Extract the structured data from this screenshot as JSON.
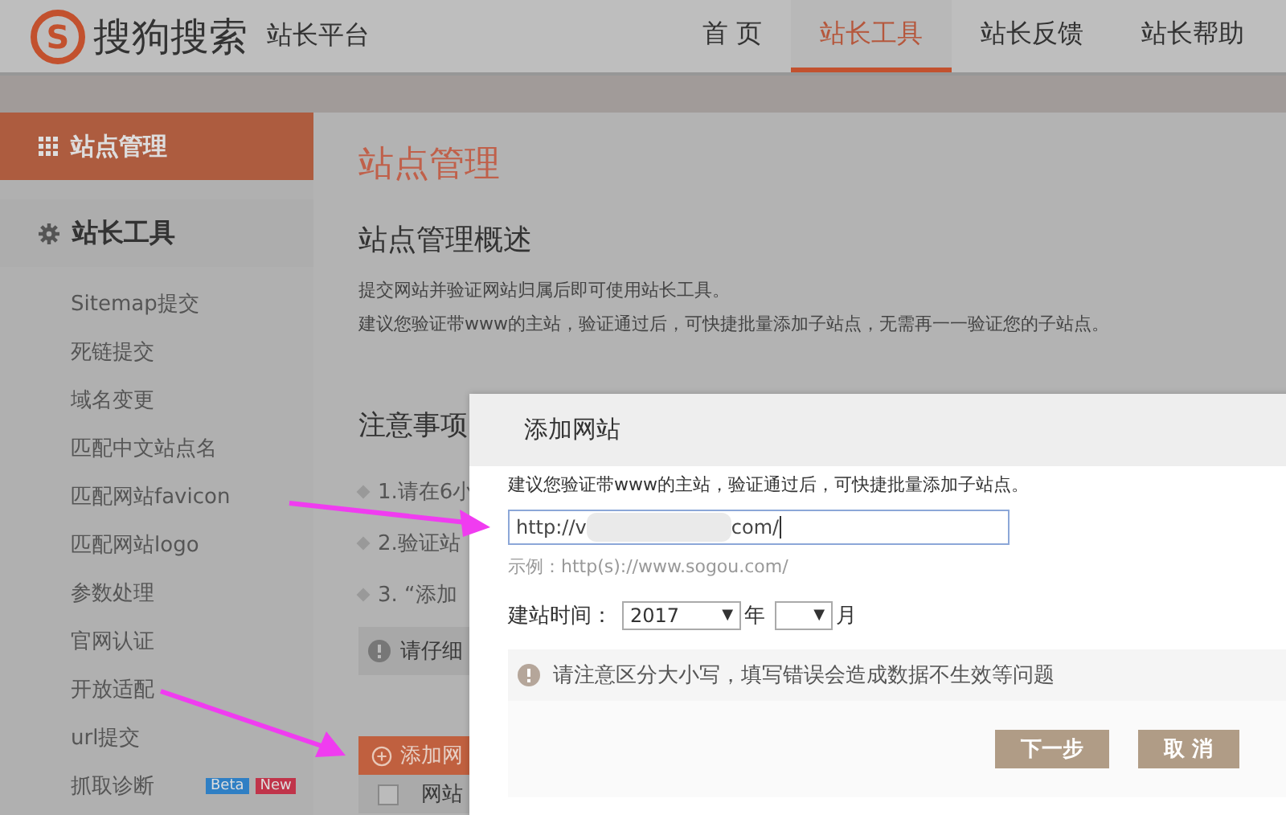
{
  "header": {
    "logo_letter": "S",
    "logo_text": "搜狗搜索",
    "platform": "站长平台",
    "nav": [
      {
        "label": "首 页",
        "selected": false
      },
      {
        "label": "站长工具",
        "selected": true
      },
      {
        "label": "站长反馈",
        "selected": false
      },
      {
        "label": "站长帮助",
        "selected": false
      }
    ]
  },
  "sidebar": {
    "active_section": "站点管理",
    "section": "站长工具",
    "items": [
      {
        "label": "Sitemap提交"
      },
      {
        "label": "死链提交"
      },
      {
        "label": "域名变更"
      },
      {
        "label": "匹配中文站点名"
      },
      {
        "label": "匹配网站favicon"
      },
      {
        "label": "匹配网站logo"
      },
      {
        "label": "参数处理"
      },
      {
        "label": "官网认证"
      },
      {
        "label": "开放适配"
      },
      {
        "label": "url提交"
      },
      {
        "label": "抓取诊断",
        "badges": [
          {
            "text": "Beta",
            "color": "#2f7fc4"
          },
          {
            "text": "New",
            "color": "#c0344a"
          }
        ]
      }
    ]
  },
  "main": {
    "title": "站点管理",
    "overview_heading": "站点管理概述",
    "overview_lines": [
      "提交网站并验证网站归属后即可使用站长工具。",
      "建议您验证带www的主站，验证通过后，可快捷批量添加子站点，无需再一一验证您的子站点。"
    ],
    "notes_heading": "注意事项",
    "notes": [
      "1.请在6小",
      "2.验证站",
      "3. “添加"
    ],
    "warning": "请仔细",
    "add_button": "添加网",
    "table_header": "网站",
    "table_checkbox_checked": false
  },
  "dialog": {
    "title": "添加网站",
    "hint": "建议您验证带www的主站，验证通过后，可快捷批量添加子站点。",
    "url_start": "http://v",
    "url_end": "com/",
    "example": "示例：http(s)://www.sogou.com/",
    "date_label": "建站时间：",
    "year": "2017",
    "dropdown_arrows": [
      "▼",
      "▼"
    ],
    "year_unit": "年",
    "month_unit": "月",
    "alert": "请注意区分大小写，填写错误会造成数据不生效等问题",
    "buttons": [
      "下一步",
      "取 消"
    ]
  }
}
